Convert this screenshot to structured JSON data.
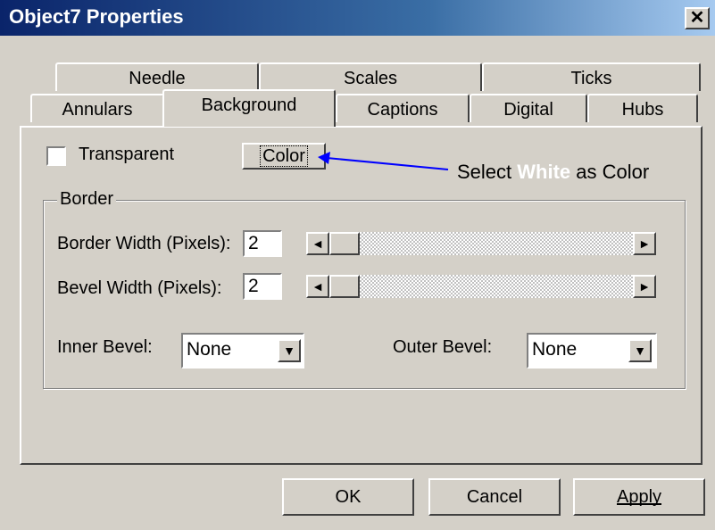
{
  "window": {
    "title": "Object7 Properties",
    "close_glyph": "✕"
  },
  "tabs_back": [
    {
      "label": "Needle"
    },
    {
      "label": "Scales"
    },
    {
      "label": "Ticks"
    }
  ],
  "tabs_front": [
    {
      "label": "Annulars"
    },
    {
      "label": "Background",
      "selected": true
    },
    {
      "label": "Captions"
    },
    {
      "label": "Digital"
    },
    {
      "label": "Hubs"
    }
  ],
  "background_tab": {
    "transparent_label": "Transparent",
    "transparent_checked": false,
    "color_button_label": "Color",
    "border_group_label": "Border",
    "border_width_label": "Border Width (Pixels):",
    "border_width_value": "2",
    "bevel_width_label": "Bevel Width (Pixels):",
    "bevel_width_value": "2",
    "inner_bevel_label": "Inner Bevel:",
    "inner_bevel_value": "None",
    "outer_bevel_label": "Outer Bevel:",
    "outer_bevel_value": "None"
  },
  "annotation": {
    "prefix": "Select",
    "highlight": "White",
    "suffix": "as Color",
    "arrow_color": "#0000ff",
    "highlight_color": "#ffffff"
  },
  "buttons": {
    "ok": "OK",
    "cancel": "Cancel",
    "apply": "Apply"
  },
  "icons": {
    "left_arrow": "◄",
    "right_arrow": "►",
    "down_arrow": "▼"
  }
}
